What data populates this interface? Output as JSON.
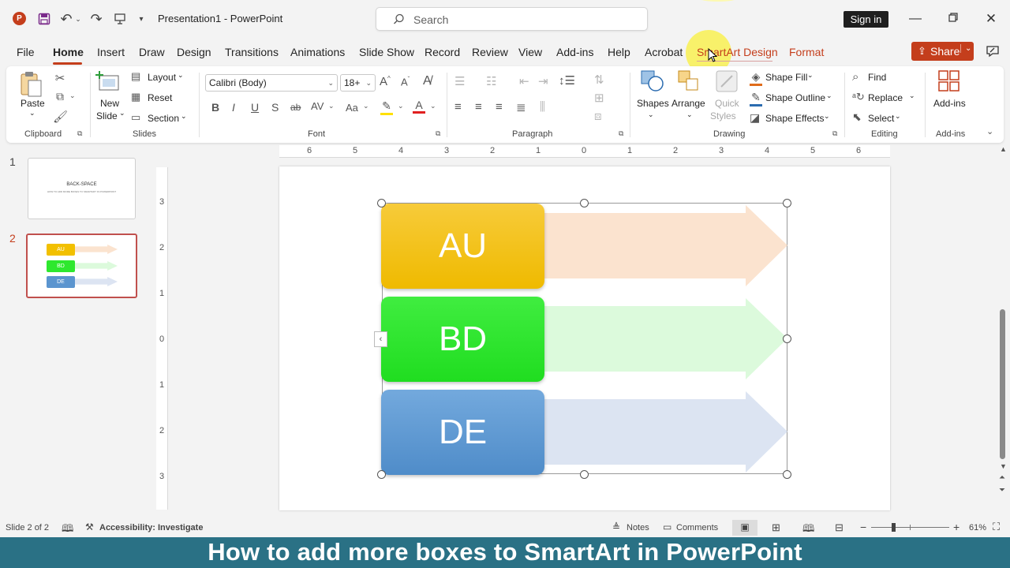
{
  "app": {
    "title": "Presentation1  -  PowerPoint",
    "search_placeholder": "Search",
    "sign_in": "Sign in",
    "share": "Share"
  },
  "tabs": [
    "File",
    "Home",
    "Insert",
    "Draw",
    "Design",
    "Transitions",
    "Animations",
    "Slide Show",
    "Record",
    "Review",
    "View",
    "Add-ins",
    "Help",
    "Acrobat",
    "SmartArt Design",
    "Format"
  ],
  "active_tab": "Home",
  "ribbon": {
    "clipboard": {
      "paste": "Paste",
      "group": "Clipboard"
    },
    "slides": {
      "new_slide_1": "New",
      "new_slide_2": "Slide",
      "layout": "Layout",
      "reset": "Reset",
      "section": "Section",
      "group": "Slides"
    },
    "font": {
      "name": "Calibri (Body)",
      "size": "18+",
      "group": "Font"
    },
    "paragraph": {
      "group": "Paragraph"
    },
    "drawing": {
      "shapes": "Shapes",
      "arrange": "Arrange",
      "quick_styles_1": "Quick",
      "quick_styles_2": "Styles",
      "shape_fill": "Shape Fill",
      "shape_outline": "Shape Outline",
      "shape_effects": "Shape Effects",
      "group": "Drawing"
    },
    "editing": {
      "find": "Find",
      "replace": "Replace",
      "select": "Select",
      "group": "Editing"
    },
    "addins": {
      "label": "Add-ins",
      "group": "Add-ins"
    }
  },
  "thumbnails": [
    {
      "number": "1",
      "title": "BACK-SPACE",
      "subtitle": "HOW TO ADD MORE BOXES TO SMARTART IN POWERPOINT"
    },
    {
      "number": "2",
      "items": [
        "AU",
        "BD",
        "DE"
      ]
    }
  ],
  "ruler": {
    "horizontal": [
      "6",
      "5",
      "4",
      "3",
      "2",
      "1",
      "0",
      "1",
      "2",
      "3",
      "4",
      "5",
      "6"
    ],
    "vertical": [
      "3",
      "2",
      "1",
      "0",
      "1",
      "2",
      "3"
    ]
  },
  "smartart": {
    "items": [
      {
        "label": "AU",
        "color": "#f2c000",
        "arrow": "#fbe3cf"
      },
      {
        "label": "BD",
        "color": "#2ee82e",
        "arrow": "#dcfadc"
      },
      {
        "label": "DE",
        "color": "#5b95cf",
        "arrow": "#dce4f2"
      }
    ]
  },
  "status": {
    "slide": "Slide 2 of 2",
    "accessibility": "Accessibility: Investigate",
    "notes": "Notes",
    "comments": "Comments",
    "zoom": "61%"
  },
  "caption": "How to add more boxes to SmartArt in PowerPoint",
  "colors": {
    "accent": "#c43e1c",
    "caption_bg": "#2a7185"
  }
}
